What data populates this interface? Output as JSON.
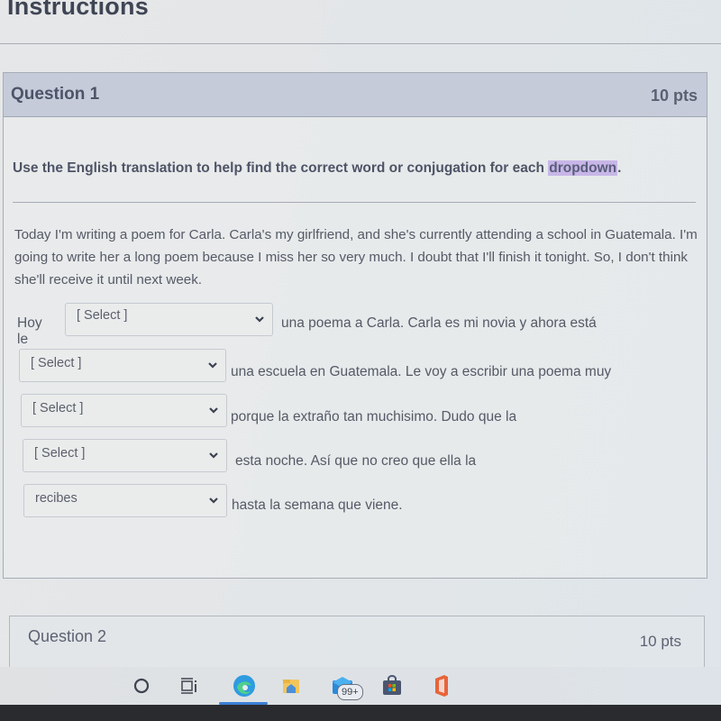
{
  "page": {
    "heading": "Instructions"
  },
  "question1": {
    "title": "Question 1",
    "points": "10 pts",
    "prompt_before": "Use the English translation to help find the correct word or conjugation for each ",
    "prompt_highlight": "dropdown",
    "prompt_after": ".",
    "paragraph": "Today I'm writing a poem for Carla. Carla's my girlfriend, and she's currently attending a school in Guatemala. I'm going to write her a long poem because I miss her so very much. I doubt that I'll finish it tonight. So, I don't think she'll receive it until next week.",
    "rows": [
      {
        "lead": "Hoy le",
        "select_value": "[ Select ]",
        "trail": "una poema a Carla. Carla es mi novia y ahora está"
      },
      {
        "lead": "",
        "select_value": "[ Select ]",
        "trail": "una escuela en Guatemala. Le voy a escribir una poema muy"
      },
      {
        "lead": "",
        "select_value": "[ Select ]",
        "trail": "porque la extraño tan muchisimo. Dudo que la"
      },
      {
        "lead": "",
        "select_value": "[ Select ]",
        "trail": "esta noche. Así que no creo que ella la"
      },
      {
        "lead": "",
        "select_value": "recibes",
        "trail": "hasta la semana que viene."
      }
    ]
  },
  "question2": {
    "title": "Question 2",
    "points": "10 pts"
  },
  "taskbar": {
    "icons": [
      "search-icon",
      "task-view-icon",
      "edge-browser-icon",
      "file-explorer-icon",
      "mail-icon",
      "microsoft-store-icon",
      "office-icon"
    ],
    "mail_badge": "99+"
  },
  "colors": {
    "question_header_bg": "#c5cbd9",
    "highlight": "#c7b6e8",
    "active_underline": "#3b7fd6"
  }
}
